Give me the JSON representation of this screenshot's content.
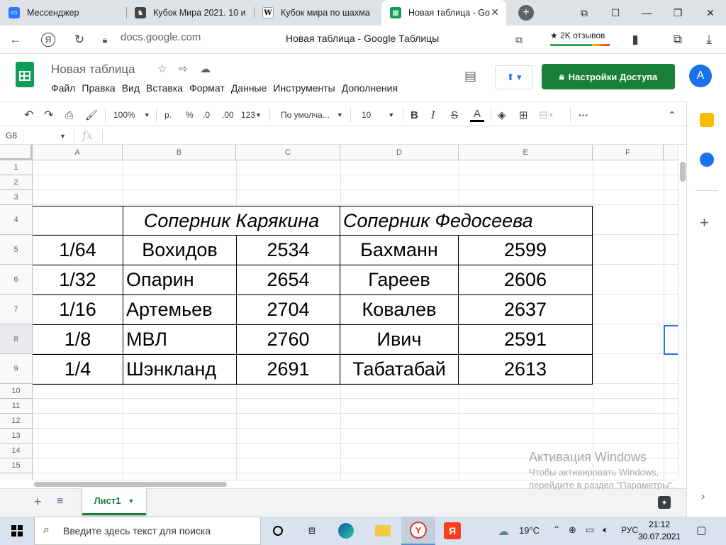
{
  "browser": {
    "tabs": [
      {
        "label": "Мессенджер",
        "favicon_color": "#2979ff"
      },
      {
        "label": "Кубок Мира 2021. 10 и",
        "favicon_color": "#444444"
      },
      {
        "label": "Кубок мира по шахма",
        "favicon_color": "#ffffff"
      },
      {
        "label": "Новая таблица - Go",
        "favicon_color": "#0f9d58"
      }
    ],
    "url": "docs.google.com",
    "page_title": "Новая таблица - Google Таблицы",
    "reviews": "★ 2K отзывов"
  },
  "sheets": {
    "doc_title": "Новая таблица",
    "menus": [
      "Файл",
      "Правка",
      "Вид",
      "Вставка",
      "Формат",
      "Данные",
      "Инструменты",
      "Дополнения"
    ],
    "share_label": "Настройки Доступа",
    "avatar_letter": "A"
  },
  "toolbar": {
    "zoom": "100%",
    "currency": "р.",
    "percent": "%",
    "dec_decrease": ".0",
    "dec_increase": ".00",
    "more_formats": "123",
    "font": "По умолча...",
    "font_size": "10",
    "bold": "B",
    "italic": "I",
    "strike": "S",
    "text_color": "A",
    "more": "···"
  },
  "formula_bar": {
    "cell_ref": "G8",
    "fx": "fx"
  },
  "columns": [
    "A",
    "B",
    "C",
    "D",
    "E",
    "F"
  ],
  "rows": [
    "1",
    "2",
    "3",
    "4",
    "5",
    "6",
    "7",
    "8",
    "9",
    "10",
    "11",
    "12",
    "13",
    "14",
    "15"
  ],
  "table": {
    "header": {
      "b": "Соперник Карякина",
      "d": "Соперник Федосеева"
    },
    "rows": [
      {
        "a": "1/64",
        "b": "Вохидов",
        "c": "2534",
        "d": "Бахманн",
        "e": "2599"
      },
      {
        "a": "1/32",
        "b": "Опарин",
        "c": "2654",
        "d": "Гареев",
        "e": "2606"
      },
      {
        "a": "1/16",
        "b": "Артемьев",
        "c": "2704",
        "d": "Ковалев",
        "e": "2637"
      },
      {
        "a": "1/8",
        "b": "МВЛ",
        "c": "2760",
        "d": "Ивич",
        "e": "2591"
      },
      {
        "a": "1/4",
        "b": "Шэнкланд",
        "c": "2691",
        "d": "Табатабай",
        "e": "2613"
      }
    ]
  },
  "sheet_tab": "Лист1",
  "activation": {
    "line1": "Активация Windows",
    "line2": "Чтобы активировать Windows,",
    "line3": "перейдите в раздел \"Параметры\"."
  },
  "taskbar": {
    "search_placeholder": "Введите здесь текст для поиска",
    "weather": "19°C",
    "lang": "РУС",
    "time": "21:12",
    "date": "30.07.2021"
  }
}
